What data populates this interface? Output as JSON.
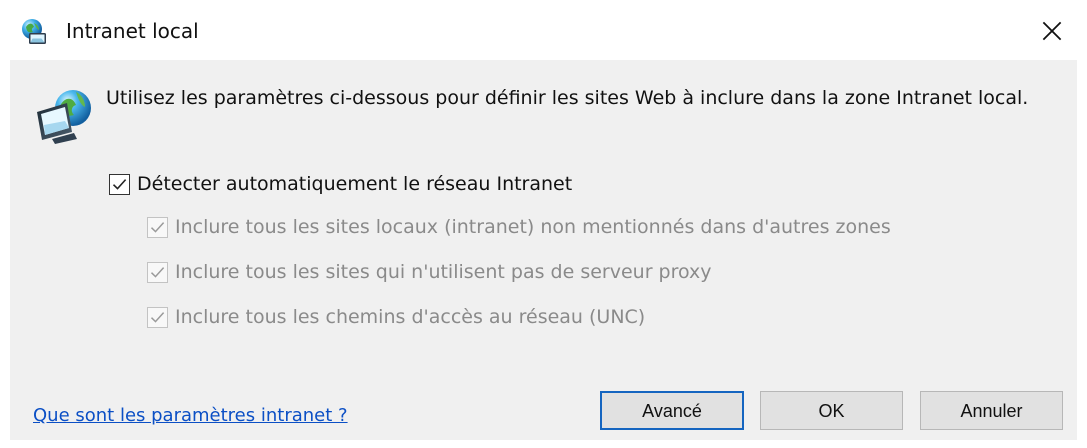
{
  "window": {
    "title": "Intranet local",
    "title_icon": "globe-computer-icon",
    "close_icon": "close-icon"
  },
  "content": {
    "hero_icon": "globe-monitor-icon",
    "intro": "Utilisez les paramètres ci-dessous pour définir les sites Web à inclure dans la zone Intranet local.",
    "options": {
      "main": {
        "label": "Détecter automatiquement le réseau Intranet",
        "checked": true,
        "enabled": true
      },
      "sub": [
        {
          "label": "Inclure tous les sites locaux (intranet) non mentionnés dans d'autres zones",
          "checked": true,
          "enabled": false
        },
        {
          "label": "Inclure tous les sites qui n'utilisent pas de serveur proxy",
          "checked": true,
          "enabled": false
        },
        {
          "label": "Inclure tous les chemins d'accès au réseau (UNC)",
          "checked": true,
          "enabled": false
        }
      ]
    }
  },
  "footer": {
    "link": "Que sont les paramètres intranet ?",
    "buttons": {
      "advanced": "Avancé",
      "ok": "OK",
      "cancel": "Annuler"
    }
  },
  "colors": {
    "dialog_background": "#f0f0f0",
    "link": "#0b4fc5",
    "focused_button_border": "#1565c0",
    "disabled_text": "#8a8a8a"
  }
}
